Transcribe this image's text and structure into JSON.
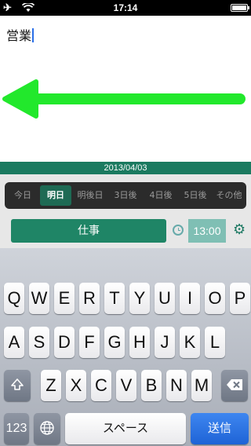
{
  "status_bar": {
    "time": "17:14"
  },
  "editor": {
    "text": "営業"
  },
  "date": "2013/04/03",
  "days": [
    "今日",
    "明日",
    "明後日",
    "3日後",
    "4日後",
    "5日後",
    "その他"
  ],
  "selected_day_index": 1,
  "job_button": "仕事",
  "time_button": "13:00",
  "keyboard": {
    "row1": [
      "Q",
      "W",
      "E",
      "R",
      "T",
      "Y",
      "U",
      "I",
      "O",
      "P"
    ],
    "row2": [
      "A",
      "S",
      "D",
      "F",
      "G",
      "H",
      "J",
      "K",
      "L"
    ],
    "row3": [
      "Z",
      "X",
      "C",
      "V",
      "B",
      "N",
      "M"
    ],
    "numbers_key": "123",
    "space_key": "スペース",
    "send_key": "送信"
  },
  "colors": {
    "accent": "#1f8566",
    "arrow": "#22e82c",
    "send": "#1e63d6"
  }
}
